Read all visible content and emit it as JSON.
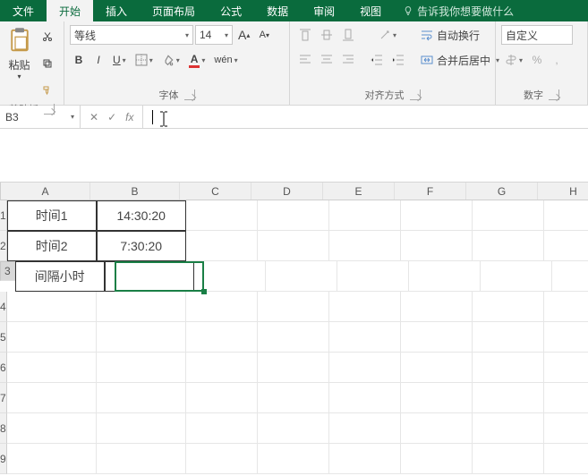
{
  "tabs": {
    "file": "文件",
    "home": "开始",
    "insert": "插入",
    "layout": "页面布局",
    "formula": "公式",
    "data": "数据",
    "review": "审阅",
    "view": "视图",
    "tell": "告诉我你想要做什么"
  },
  "ribbon": {
    "clipboard": {
      "paste": "粘贴",
      "group_label": "剪贴板"
    },
    "font": {
      "family": "等线",
      "size": "14",
      "bold": "B",
      "italic": "I",
      "underline": "U",
      "wen": "wén",
      "group_label": "字体"
    },
    "align": {
      "wrap": "自动换行",
      "merge": "合并后居中",
      "group_label": "对齐方式"
    },
    "number": {
      "format": "自定义",
      "group_label": "数字"
    }
  },
  "formula_bar": {
    "name": "B3",
    "fx": "fx",
    "content": ""
  },
  "columns": [
    "A",
    "B",
    "C",
    "D",
    "E",
    "F",
    "G",
    "H"
  ],
  "rows": [
    "1",
    "2",
    "3",
    "4",
    "5",
    "6",
    "7",
    "8",
    "9"
  ],
  "cells": {
    "A1": "时间1",
    "B1": "14:30:20",
    "A2": "时间2",
    "B2": "7:30:20",
    "A3": "间隔小时",
    "B3": ""
  },
  "selection": {
    "cell": "B3"
  }
}
